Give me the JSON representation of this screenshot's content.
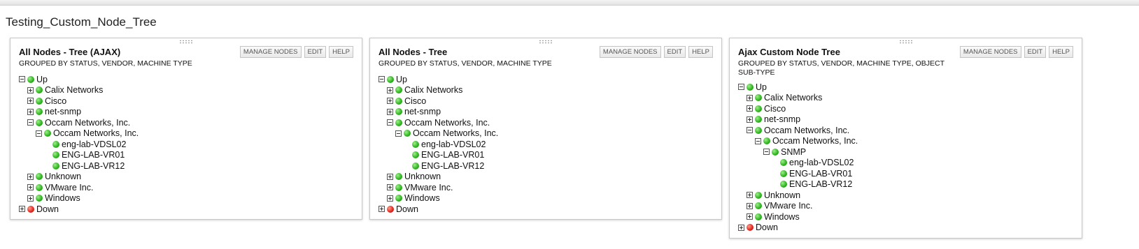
{
  "page_title": "Testing_Custom_Node_Tree",
  "colors": {
    "up": "#2bb21c",
    "down": "#e0241a"
  },
  "panels": [
    {
      "title": "All Nodes - Tree (AJAX)",
      "subtitle": "GROUPED BY STATUS, VENDOR, MACHINE TYPE",
      "buttons": [
        "MANAGE NODES",
        "EDIT",
        "HELP"
      ],
      "tree": [
        {
          "level": 0,
          "toggle": "expanded",
          "status": "up",
          "label": "Up"
        },
        {
          "level": 1,
          "toggle": "collapsed",
          "status": "up",
          "label": "Calix Networks"
        },
        {
          "level": 1,
          "toggle": "collapsed",
          "status": "up",
          "label": "Cisco"
        },
        {
          "level": 1,
          "toggle": "collapsed",
          "status": "up",
          "label": "net-snmp"
        },
        {
          "level": 1,
          "toggle": "expanded",
          "status": "up",
          "label": "Occam Networks, Inc."
        },
        {
          "level": 2,
          "toggle": "expanded",
          "status": "up",
          "label": "Occam Networks, Inc."
        },
        {
          "level": 3,
          "toggle": "none",
          "status": "up",
          "label": "eng-lab-VDSL02"
        },
        {
          "level": 3,
          "toggle": "none",
          "status": "up",
          "label": "ENG-LAB-VR01"
        },
        {
          "level": 3,
          "toggle": "none",
          "status": "up",
          "label": "ENG-LAB-VR12"
        },
        {
          "level": 1,
          "toggle": "collapsed",
          "status": "up",
          "label": "Unknown"
        },
        {
          "level": 1,
          "toggle": "collapsed",
          "status": "up",
          "label": "VMware Inc."
        },
        {
          "level": 1,
          "toggle": "collapsed",
          "status": "up",
          "label": "Windows"
        },
        {
          "level": 0,
          "toggle": "collapsed",
          "status": "down",
          "label": "Down"
        }
      ]
    },
    {
      "title": "All Nodes - Tree",
      "subtitle": "GROUPED BY STATUS, VENDOR, MACHINE TYPE",
      "buttons": [
        "MANAGE NODES",
        "EDIT",
        "HELP"
      ],
      "tree": [
        {
          "level": 0,
          "toggle": "expanded",
          "status": "up",
          "label": "Up"
        },
        {
          "level": 1,
          "toggle": "collapsed",
          "status": "up",
          "label": "Calix Networks"
        },
        {
          "level": 1,
          "toggle": "collapsed",
          "status": "up",
          "label": "Cisco"
        },
        {
          "level": 1,
          "toggle": "collapsed",
          "status": "up",
          "label": "net-snmp"
        },
        {
          "level": 1,
          "toggle": "expanded",
          "status": "up",
          "label": "Occam Networks, Inc."
        },
        {
          "level": 2,
          "toggle": "expanded",
          "status": "up",
          "label": "Occam Networks, Inc."
        },
        {
          "level": 3,
          "toggle": "none",
          "status": "up",
          "label": "eng-lab-VDSL02"
        },
        {
          "level": 3,
          "toggle": "none",
          "status": "up",
          "label": "ENG-LAB-VR01"
        },
        {
          "level": 3,
          "toggle": "none",
          "status": "up",
          "label": "ENG-LAB-VR12"
        },
        {
          "level": 1,
          "toggle": "collapsed",
          "status": "up",
          "label": "Unknown"
        },
        {
          "level": 1,
          "toggle": "collapsed",
          "status": "up",
          "label": "VMware Inc."
        },
        {
          "level": 1,
          "toggle": "collapsed",
          "status": "up",
          "label": "Windows"
        },
        {
          "level": 0,
          "toggle": "collapsed",
          "status": "down",
          "label": "Down"
        }
      ]
    },
    {
      "title": "Ajax Custom Node Tree",
      "subtitle": "GROUPED BY STATUS, VENDOR, MACHINE TYPE, OBJECT SUB-TYPE",
      "buttons": [
        "MANAGE NODES",
        "EDIT",
        "HELP"
      ],
      "tree": [
        {
          "level": 0,
          "toggle": "expanded",
          "status": "up",
          "label": "Up"
        },
        {
          "level": 1,
          "toggle": "collapsed",
          "status": "up",
          "label": "Calix Networks"
        },
        {
          "level": 1,
          "toggle": "collapsed",
          "status": "up",
          "label": "Cisco"
        },
        {
          "level": 1,
          "toggle": "collapsed",
          "status": "up",
          "label": "net-snmp"
        },
        {
          "level": 1,
          "toggle": "expanded",
          "status": "up",
          "label": "Occam Networks, Inc."
        },
        {
          "level": 2,
          "toggle": "expanded",
          "status": "up",
          "label": "Occam Networks, Inc."
        },
        {
          "level": 3,
          "toggle": "expanded",
          "status": "up",
          "label": "SNMP"
        },
        {
          "level": 4,
          "toggle": "none",
          "status": "up",
          "label": "eng-lab-VDSL02"
        },
        {
          "level": 4,
          "toggle": "none",
          "status": "up",
          "label": "ENG-LAB-VR01"
        },
        {
          "level": 4,
          "toggle": "none",
          "status": "up",
          "label": "ENG-LAB-VR12"
        },
        {
          "level": 1,
          "toggle": "collapsed",
          "status": "up",
          "label": "Unknown"
        },
        {
          "level": 1,
          "toggle": "collapsed",
          "status": "up",
          "label": "VMware Inc."
        },
        {
          "level": 1,
          "toggle": "collapsed",
          "status": "up",
          "label": "Windows"
        },
        {
          "level": 0,
          "toggle": "collapsed",
          "status": "down",
          "label": "Down"
        }
      ]
    }
  ]
}
